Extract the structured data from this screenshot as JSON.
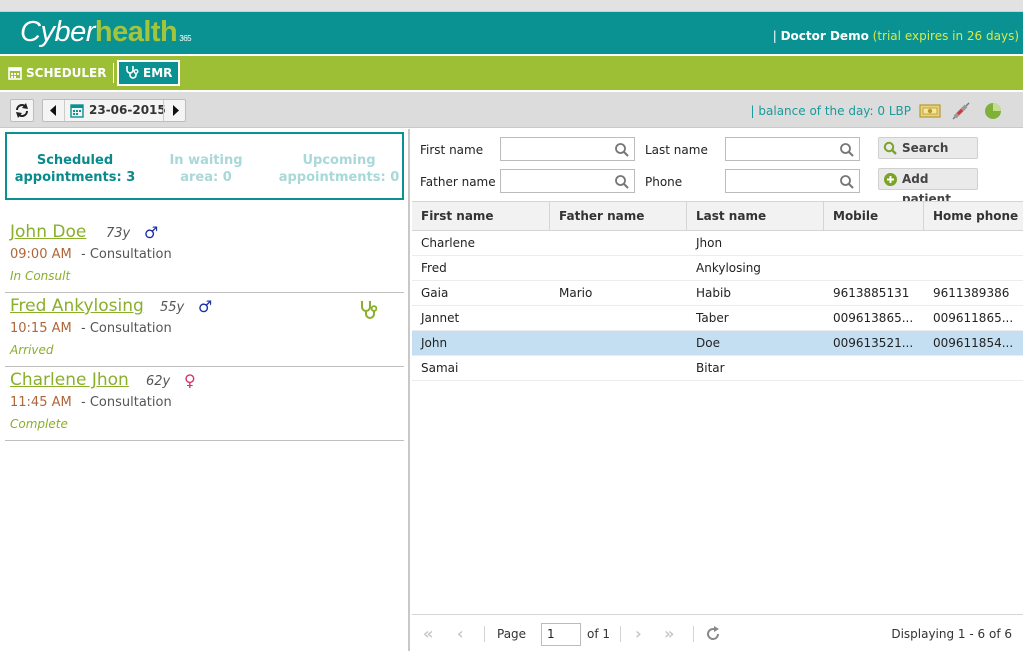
{
  "app": {
    "logo_cyber": "Cyber",
    "logo_health": "health",
    "logo_sub": "365",
    "user_prefix": "| ",
    "user_name": "Doctor Demo",
    "trial_text": "(trial expires in 26 days)"
  },
  "nav": {
    "scheduler": "SCHEDULER",
    "emr": "EMR"
  },
  "toolbar": {
    "date": "23-06-2015",
    "balance": "| balance of the day: 0 LBP"
  },
  "summary": {
    "scheduled_line1": "Scheduled",
    "scheduled_line2": "appointments: 3",
    "waiting_line1": "In waiting",
    "waiting_line2": "area: 0",
    "upcoming_line1": "Upcoming",
    "upcoming_line2": "appointments: 0"
  },
  "appointments": [
    {
      "name": "John Doe",
      "age": "73y",
      "gender": "♂",
      "time": "09:00 AM",
      "type": "- Consultation",
      "status": "In Consult"
    },
    {
      "name": "Fred Ankylosing",
      "age": "55y",
      "gender": "♂",
      "time": "10:15 AM",
      "type": "- Consultation",
      "status": "Arrived"
    },
    {
      "name": "Charlene Jhon",
      "age": "62y",
      "gender": "♀",
      "time": "11:45 AM",
      "type": "- Consultation",
      "status": "Complete"
    }
  ],
  "filters": {
    "first_name": "First name",
    "father_name": "Father name",
    "last_name": "Last name",
    "phone": "Phone",
    "search": "Search",
    "add_patient": "Add patient"
  },
  "grid": {
    "headers": [
      "First name",
      "Father name",
      "Last name",
      "Mobile",
      "Home phone"
    ],
    "rows": [
      [
        "Charlene",
        "",
        "Jhon",
        "",
        ""
      ],
      [
        "Fred",
        "",
        "Ankylosing",
        "",
        ""
      ],
      [
        "Gaia",
        "Mario",
        "Habib",
        "9613885131",
        "9611389386"
      ],
      [
        "Jannet",
        "",
        "Taber",
        "009613865...",
        "009611865..."
      ],
      [
        "John",
        "",
        "Doe",
        "009613521...",
        "009611854..."
      ],
      [
        "Samai",
        "",
        "Bitar",
        "",
        ""
      ]
    ]
  },
  "pager": {
    "page_label": "Page",
    "page_value": "1",
    "of_label": "of 1",
    "displaying": "Displaying 1 - 6 of 6"
  },
  "colors": {
    "teal": "#0a9191",
    "green": "#9cbf36",
    "selected_row": "#c5dff2",
    "male": "#1a2fa8",
    "female": "#d6336c"
  }
}
